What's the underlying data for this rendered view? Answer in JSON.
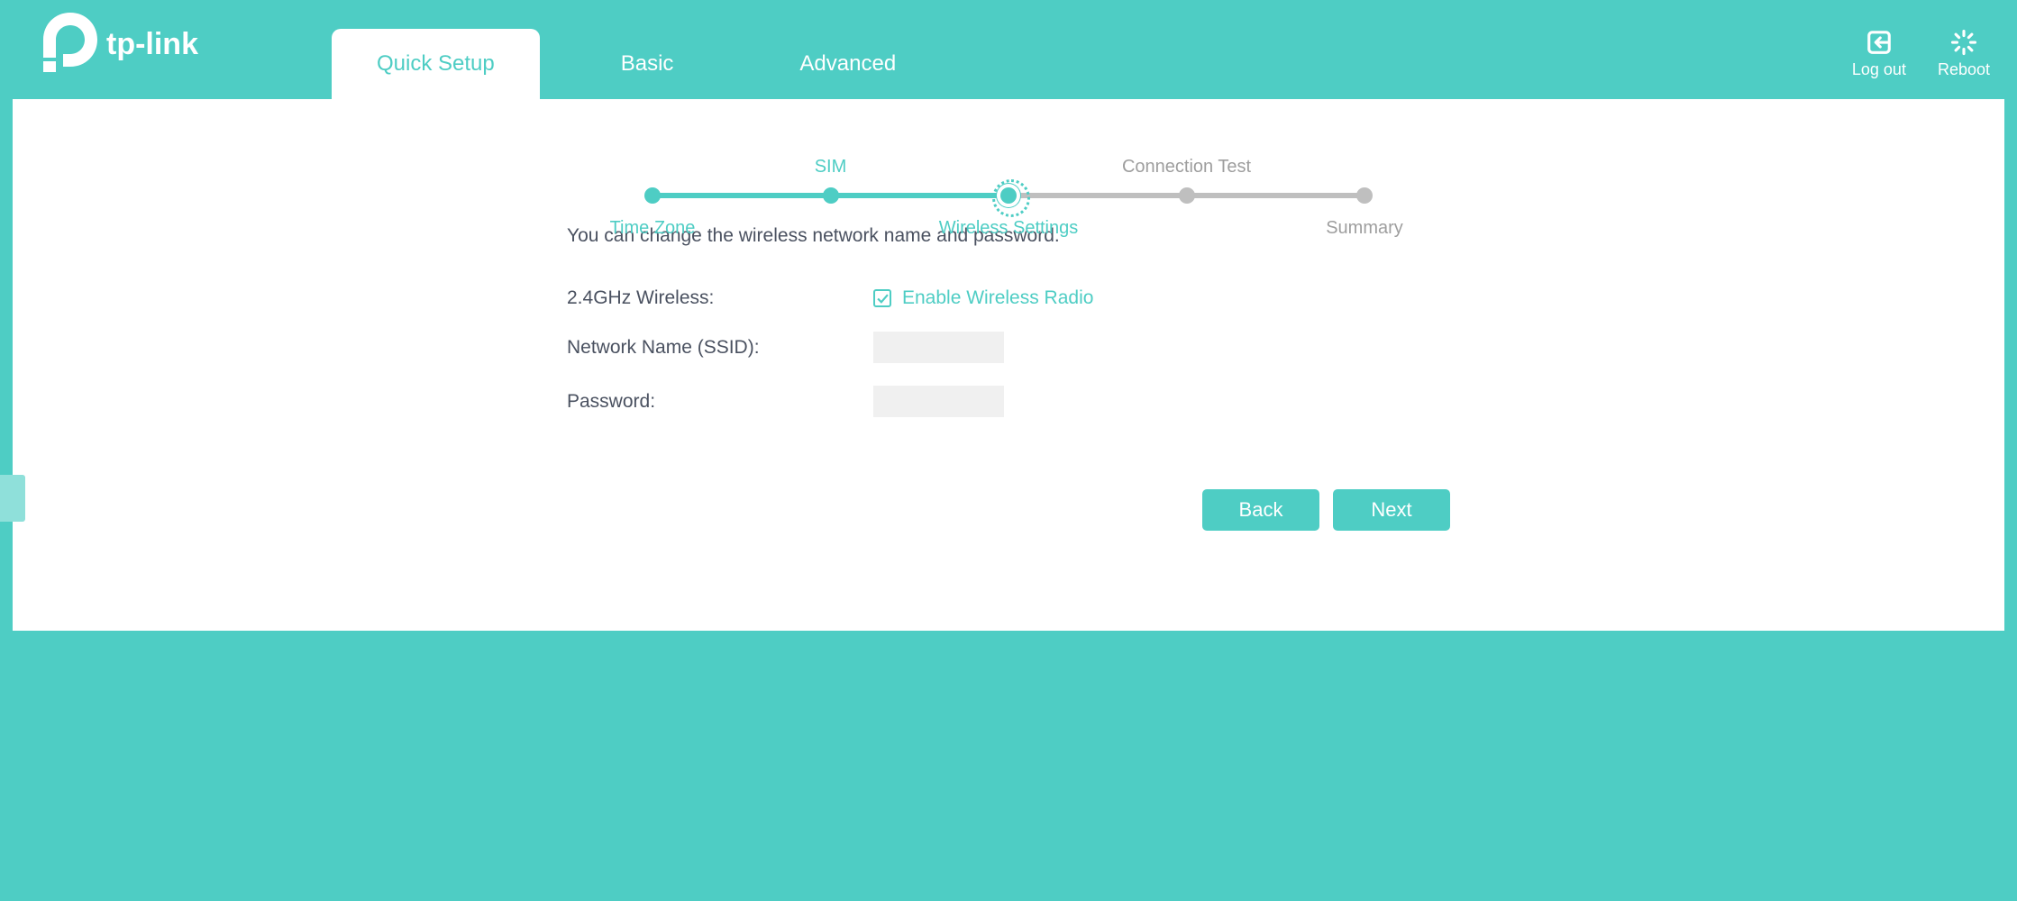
{
  "brand": {
    "name": "tp-link"
  },
  "tabs": [
    {
      "label": "Quick Setup",
      "active": true
    },
    {
      "label": "Basic",
      "active": false
    },
    {
      "label": "Advanced",
      "active": false
    }
  ],
  "actions": {
    "logout": "Log out",
    "reboot": "Reboot"
  },
  "stepper": {
    "steps": [
      {
        "label": "Time Zone",
        "pos": "below",
        "state": "done"
      },
      {
        "label": "SIM",
        "pos": "above",
        "state": "done"
      },
      {
        "label": "Wireless Settings",
        "pos": "below",
        "state": "current"
      },
      {
        "label": "Connection Test",
        "pos": "above",
        "state": "pending"
      },
      {
        "label": "Summary",
        "pos": "below",
        "state": "pending"
      }
    ]
  },
  "form": {
    "intro": "You can change the wireless network name and password.",
    "wireless24_label": "2.4GHz Wireless:",
    "enable_radio_label": "Enable Wireless Radio",
    "enable_radio_checked": true,
    "ssid_label": "Network Name (SSID):",
    "ssid_value": "",
    "password_label": "Password:",
    "password_value": ""
  },
  "buttons": {
    "back": "Back",
    "next": "Next"
  }
}
